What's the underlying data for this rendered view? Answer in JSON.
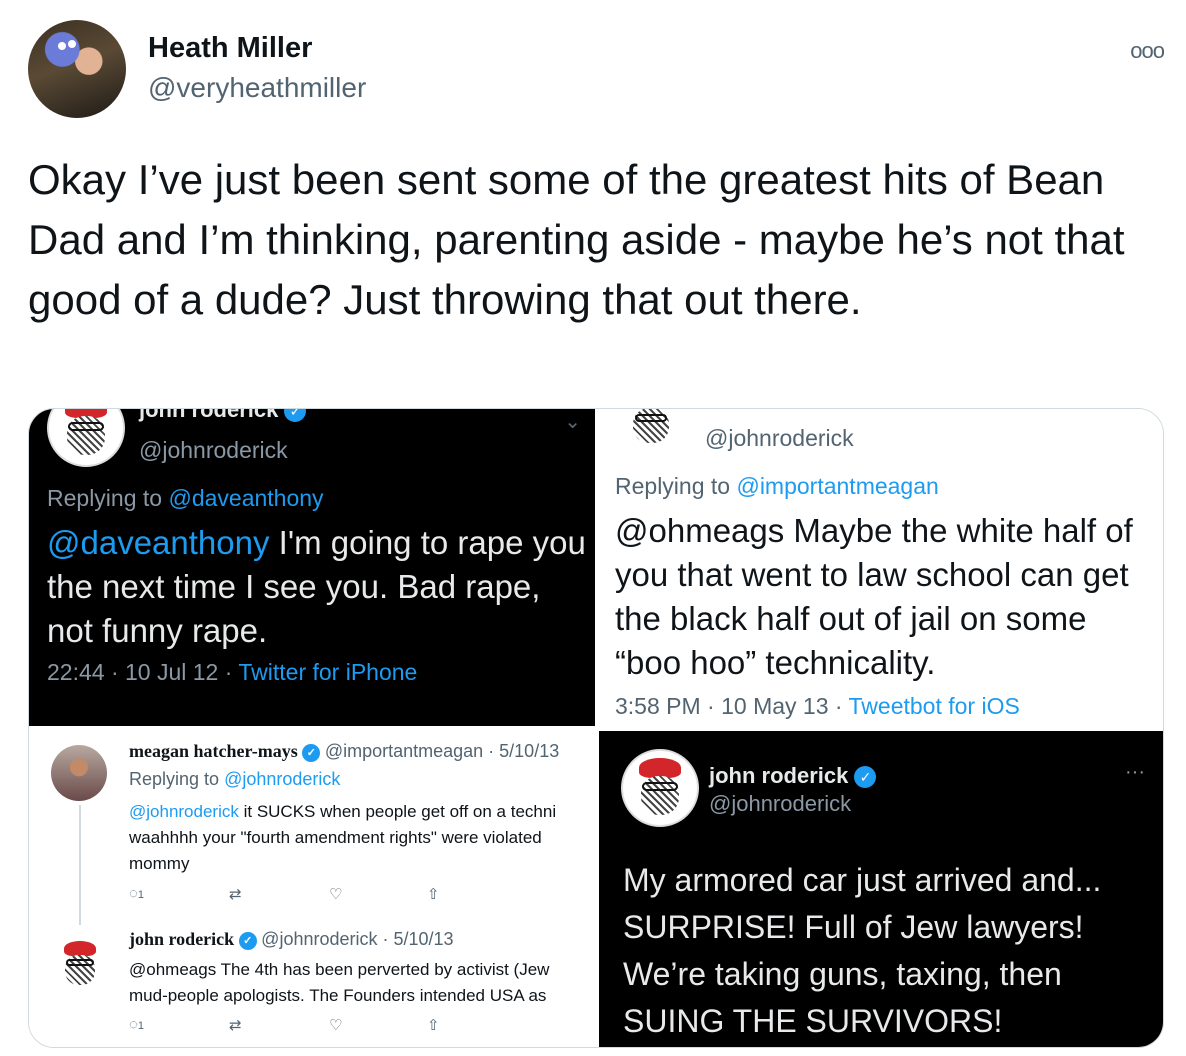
{
  "author": {
    "name": "Heath Miller",
    "handle": "@veryheathmiller",
    "more_icon": "ooo"
  },
  "tweet": {
    "text": "Okay I’ve just been sent some of the greatest hits of Bean Dad and I’m thinking, parenting aside - maybe he’s not that good of a dude? Just throwing that out there."
  },
  "media": {
    "panel1": {
      "name_cut": "john roderick",
      "handle": "@johnroderick",
      "replying_prefix": "Replying to",
      "replying_to": "@daveanthony",
      "mention": "@daveanthony",
      "body": " I'm going to rape you the next time I see you. Bad rape, not funny rape.",
      "meta_time": "22:44 · 10 Jul 12 · ",
      "meta_client": "Twitter for iPhone"
    },
    "panel2": {
      "handle": "@johnroderick",
      "replying_prefix": "Replying to",
      "replying_to": "@importantmeagan",
      "body": "@ohmeags Maybe the white half of you that went to law school can get the black half out of jail on some “boo hoo” technicality.",
      "meta_time": "3:58 PM · 10 May 13 · ",
      "meta_client": "Tweetbot for iOS"
    },
    "panel3": {
      "tweet1": {
        "name": "meagan hatcher-mays",
        "handle_date": "@importantmeagan · 5/10/13",
        "replying_prefix": "Replying to",
        "replying_to": "@johnroderick",
        "mention": "@johnroderick",
        "body": " it SUCKS when people get off on a techni\nwaahhhh your \"fourth amendment rights\" were violated \nmommy",
        "reply_count": "1"
      },
      "tweet2": {
        "name": "john roderick",
        "handle_date": "@johnroderick · 5/10/13",
        "body": "@ohmeags The 4th has been perverted by activist (Jew\nmud-people apologists. The Founders intended USA as ",
        "reply_count": "1"
      }
    },
    "panel4": {
      "name": "john roderick",
      "handle": "@johnroderick",
      "more_icon": "···",
      "body": "My armored car just arrived and...\nSURPRISE! Full of Jew lawyers!\nWe’re taking guns, taxing, then\nSUING THE SURVIVORS!"
    }
  },
  "colors": {
    "link": "#1d9bf0",
    "text": "#0f1419",
    "muted": "#536471",
    "dark_bg": "#000000"
  }
}
